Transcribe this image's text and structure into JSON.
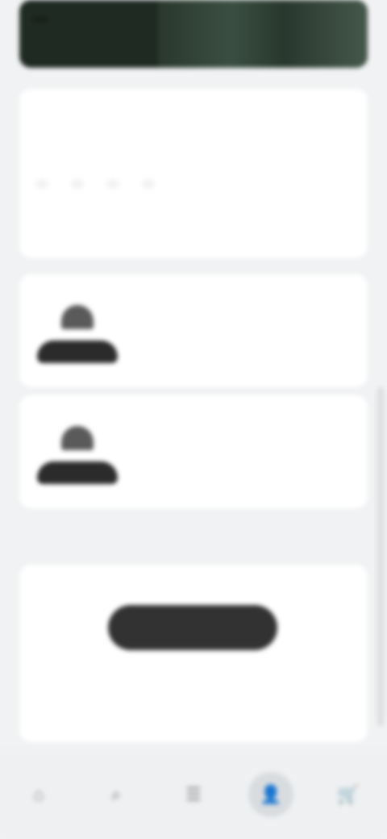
{
  "hero": {
    "label": ""
  },
  "main": {
    "section_title": "",
    "subtitle": "",
    "chips": [
      "",
      "",
      "",
      ""
    ]
  },
  "products": [
    {
      "name": "",
      "desc": ""
    },
    {
      "name": "",
      "desc": ""
    }
  ],
  "section_header": "",
  "reviews": {
    "title": "",
    "cta_label": "",
    "all_label": ""
  },
  "bottom_nav": {
    "items": [
      {
        "icon": "home-icon"
      },
      {
        "icon": "search-icon"
      },
      {
        "icon": "menu-icon"
      },
      {
        "icon": "user-icon"
      },
      {
        "icon": "cart-icon"
      }
    ]
  }
}
